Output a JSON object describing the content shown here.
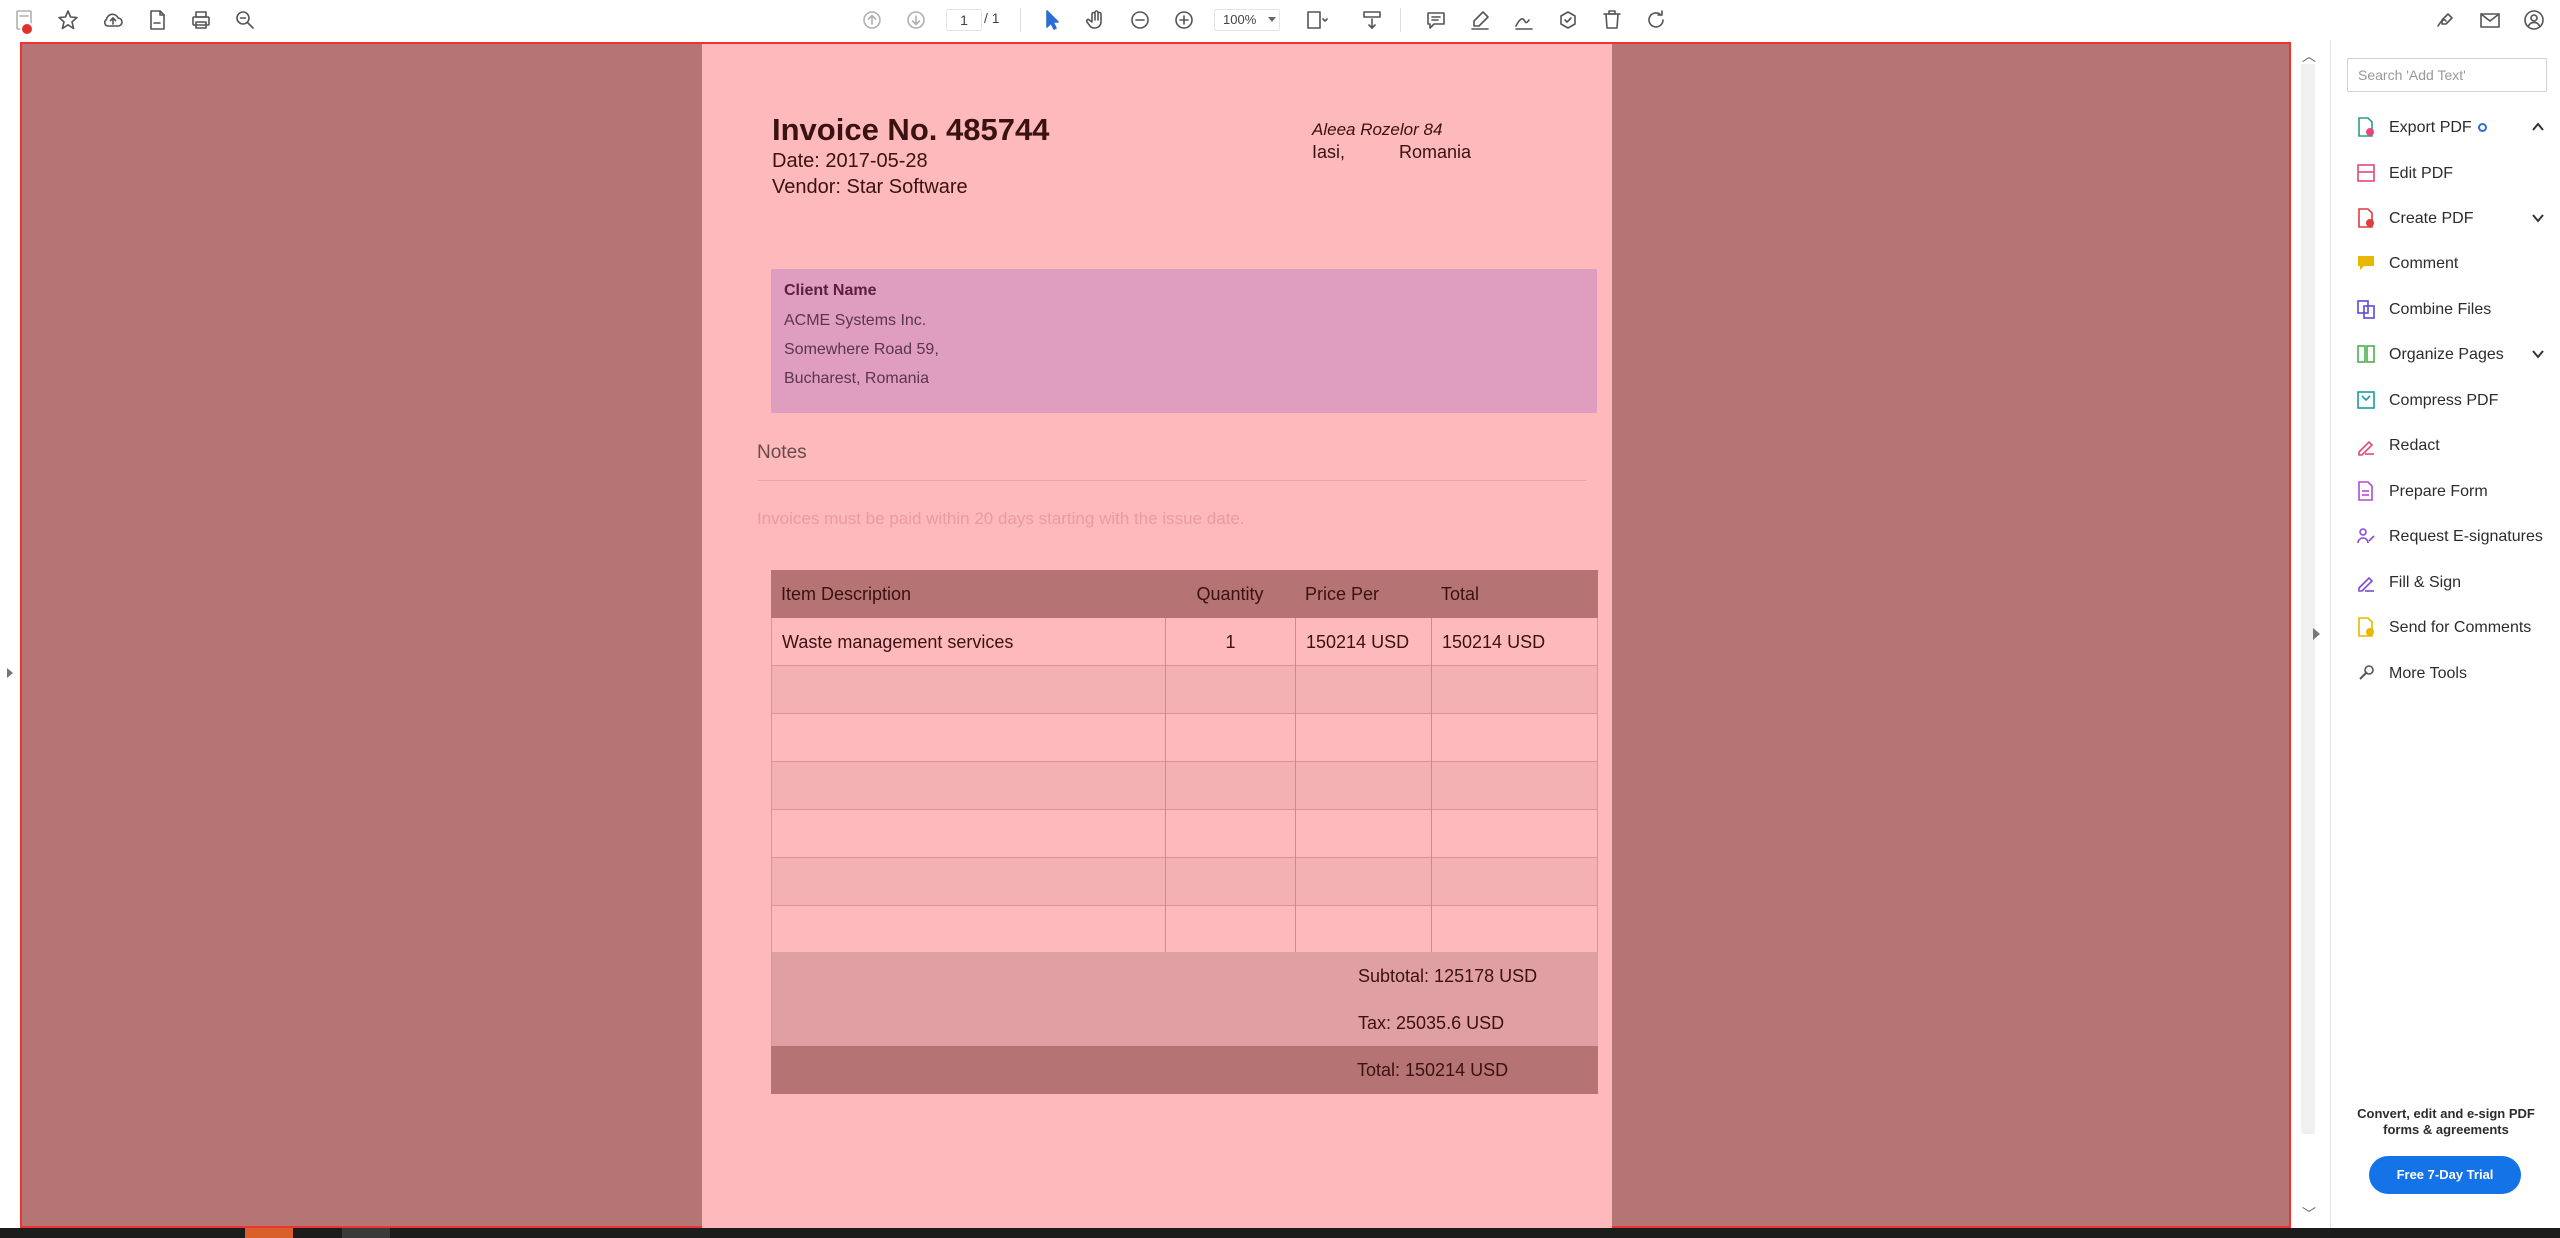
{
  "toolbar": {
    "page_current": "1",
    "page_total": "/ 1",
    "zoom": "100%"
  },
  "invoice": {
    "title": "Invoice No. 485744",
    "date": "Date: 2017-05-28",
    "vendor": "Vendor: Star Software",
    "address_line1": "Aleea Rozelor 84",
    "address_city": "Iasi,",
    "address_country": "Romania",
    "client_title": "Client Name",
    "client_lines": [
      "ACME Systems Inc.",
      "Somewhere Road 59,",
      "Bucharest, Romania"
    ],
    "notes_title": "Notes",
    "notes_text": "Invoices must be paid within 20 days starting with the issue date.",
    "table": {
      "headers": [
        "Item Description",
        "Quantity",
        "Price Per",
        "Total"
      ],
      "rows": [
        [
          "Waste management services",
          "1",
          "150214 USD",
          "150214 USD"
        ]
      ]
    },
    "subtotal": "Subtotal: 125178 USD",
    "tax": "Tax: 25035.6 USD",
    "total": "Total: 150214 USD"
  },
  "panel": {
    "search_placeholder": "Search 'Add Text'",
    "tools": [
      {
        "label": "Export PDF",
        "icon": "export-pdf-icon",
        "color": "#2a9d8f"
      },
      {
        "label": "Edit PDF",
        "icon": "edit-pdf-icon",
        "color": "#e5487a"
      },
      {
        "label": "Create PDF",
        "icon": "create-pdf-icon",
        "color": "#e03c3c"
      },
      {
        "label": "Comment",
        "icon": "comment-icon",
        "color": "#e8b800"
      },
      {
        "label": "Combine Files",
        "icon": "combine-files-icon",
        "color": "#5b4bd6"
      },
      {
        "label": "Organize Pages",
        "icon": "organize-pages-icon",
        "color": "#4caf50"
      },
      {
        "label": "Compress PDF",
        "icon": "compress-pdf-icon",
        "color": "#1a9c9c"
      },
      {
        "label": "Redact",
        "icon": "redact-icon",
        "color": "#e5487a"
      },
      {
        "label": "Prepare Form",
        "icon": "prepare-form-icon",
        "color": "#b34ad6"
      },
      {
        "label": "Request E-signatures",
        "icon": "request-esignatures-icon",
        "color": "#8b4bd6"
      },
      {
        "label": "Fill & Sign",
        "icon": "fill-sign-icon",
        "color": "#7b4bd6"
      },
      {
        "label": "Send for Comments",
        "icon": "send-for-comments-icon",
        "color": "#e8b800"
      },
      {
        "label": "More Tools",
        "icon": "more-tools-icon",
        "color": "#555555"
      }
    ],
    "promo_text_line1": "Convert, edit and e-sign PDF",
    "promo_text_line2": "forms & agreements",
    "trial_button": "Free 7-Day Trial"
  }
}
